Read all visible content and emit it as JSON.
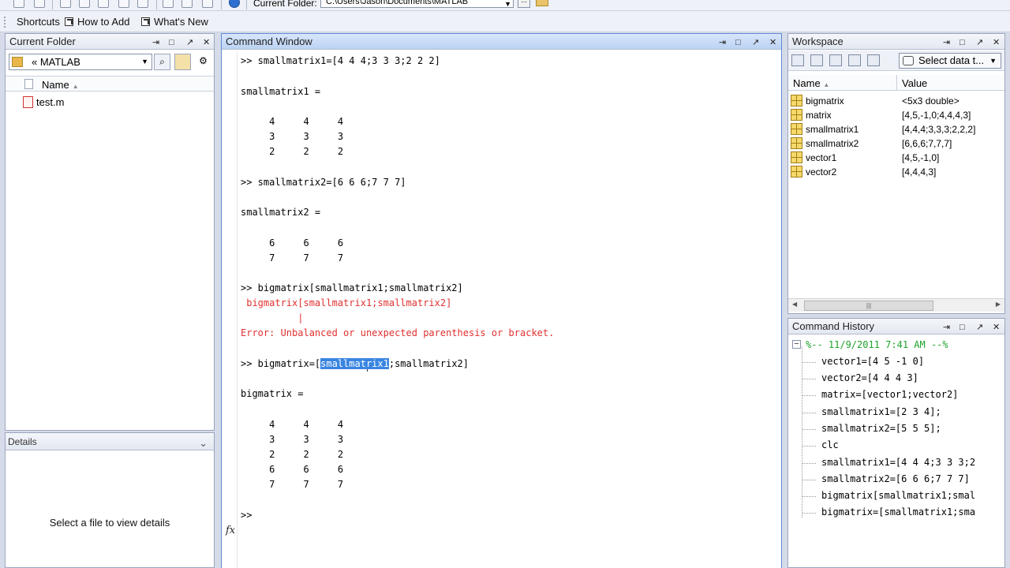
{
  "toolbar": {
    "current_folder_label": "Current Folder:",
    "current_folder_path": "C:\\Users\\Jason\\Documents\\MATLAB",
    "browse_label": "...",
    "dropdown_icon": "chevron-down-icon"
  },
  "shortcuts": {
    "items": [
      {
        "label": "Shortcuts"
      },
      {
        "label": "How to Add"
      },
      {
        "label": "What's New"
      }
    ]
  },
  "current_folder": {
    "title": "Current Folder",
    "controls": [
      "⇥",
      "□",
      "↗",
      "✕"
    ],
    "address": "« MATLAB",
    "column_name": "Name",
    "sort_indicator": "▲",
    "files": [
      {
        "name": "test.m"
      }
    ]
  },
  "details": {
    "title": "Details",
    "chevron": "⌄",
    "message": "Select a file to view details"
  },
  "command_window": {
    "title": "Command Window",
    "controls": [
      "⇥",
      "□",
      "↗",
      "✕"
    ],
    "lines": [
      ">> smallmatrix1=[4 4 4;3 3 3;2 2 2]",
      "smallmatrix1 =",
      "     4     4     4",
      "     3     3     3",
      "     2     2     2",
      ">> smallmatrix2=[6 6 6;7 7 7]",
      "smallmatrix2 =",
      "     6     6     6",
      "     7     7     7",
      ">> bigmatrix[smallmatrix1;smallmatrix2]",
      " bigmatrix[smallmatrix1;smallmatrix2]",
      "          |",
      "Error: Unbalanced or unexpected parenthesis or bracket.",
      "bigmatrix =",
      "     4     4     4",
      "     3     3     3",
      "     2     2     2",
      "     6     6     6",
      "     7     7     7"
    ],
    "selected_cmd": {
      "prefix": ">> bigmatrix=[",
      "selected": "smallmatrix1",
      "suffix": ";smallmatrix2]"
    },
    "fx_label": "fx",
    "prompt": ">>"
  },
  "workspace": {
    "title": "Workspace",
    "controls": [
      "⇥",
      "□",
      "↗",
      "✕"
    ],
    "select_data_label": "Select data t...",
    "col_name": "Name",
    "sort_indicator": "▲",
    "col_value": "Value",
    "variables": [
      {
        "name": "bigmatrix",
        "value": "<5x3 double>"
      },
      {
        "name": "matrix",
        "value": "[4,5,-1,0;4,4,4,3]"
      },
      {
        "name": "smallmatrix1",
        "value": "[4,4,4;3,3,3;2,2,2]"
      },
      {
        "name": "smallmatrix2",
        "value": "[6,6,6;7,7,7]"
      },
      {
        "name": "vector1",
        "value": "[4,5,-1,0]"
      },
      {
        "name": "vector2",
        "value": "[4,4,4,3]"
      }
    ],
    "scroll_left": "◀",
    "scroll_right": "▶",
    "scroll_grip": "|||"
  },
  "command_history": {
    "title": "Command History",
    "controls": [
      "⇥",
      "□",
      "↗",
      "✕"
    ],
    "collapse": "−",
    "session_header": "%-- 11/9/2011 7:41 AM --%",
    "entries": [
      "vector1=[4 5 -1 0]",
      "vector2=[4 4 4 3]",
      "matrix=[vector1;vector2]",
      "smallmatrix1=[2 3 4];",
      "smallmatrix2=[5 5 5];",
      "clc",
      "smallmatrix1=[4 4 4;3 3 3;2",
      "smallmatrix2=[6 6 6;7 7 7]",
      "bigmatrix[smallmatrix1;smal",
      "bigmatrix=[smallmatrix1;sma"
    ]
  },
  "colors": {
    "error": "#e0312f",
    "selection": "#3a86e0",
    "history_header": "#1fa32b",
    "active_title": "#bcd3f3"
  }
}
